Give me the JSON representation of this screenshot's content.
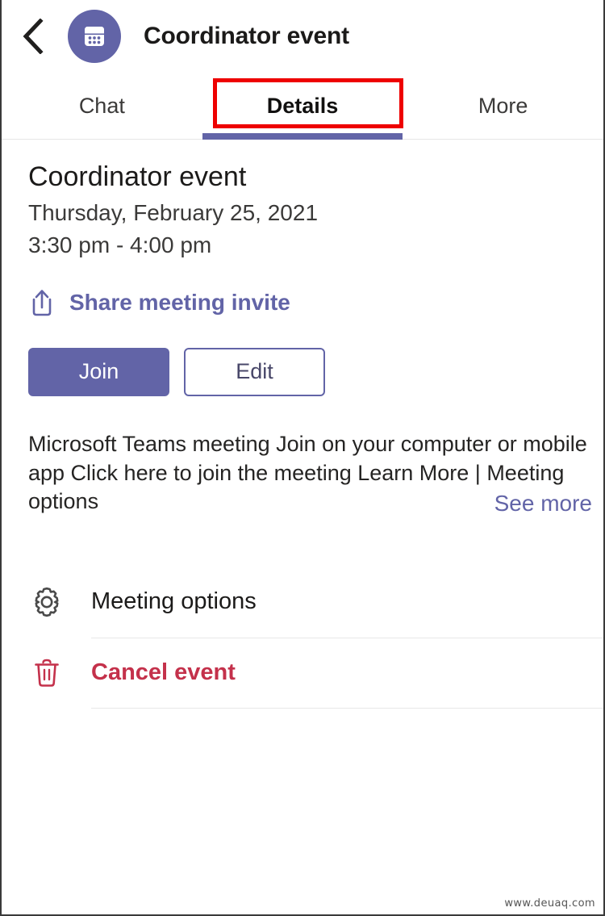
{
  "theme": {
    "brand_purple": "#6264a7",
    "danger_red": "#c4314b",
    "annotation_red": "#ee0000",
    "text_dark": "#1b1a19"
  },
  "header": {
    "back_icon": "chevron-left-icon",
    "avatar_icon": "calendar-icon",
    "title": "Coordinator event"
  },
  "tabs": [
    {
      "label": "Chat",
      "active": false
    },
    {
      "label": "Details",
      "active": true
    },
    {
      "label": "More",
      "active": false
    }
  ],
  "event": {
    "title": "Coordinator event",
    "date": "Thursday, February 25, 2021",
    "time": "3:30 pm - 4:00 pm",
    "share_icon": "share-icon",
    "share_label": "Share meeting invite",
    "join_label": "Join",
    "edit_label": "Edit",
    "description": " Microsoft Teams meeting Join on your computer or mobile app Click here to join the meeting Learn More | Meeting options",
    "see_more_label": "See more"
  },
  "actions": [
    {
      "icon": "gear-icon",
      "label": "Meeting options",
      "danger": false
    },
    {
      "icon": "trash-icon",
      "label": "Cancel event",
      "danger": true
    }
  ],
  "watermark": "www.deuaq.com"
}
